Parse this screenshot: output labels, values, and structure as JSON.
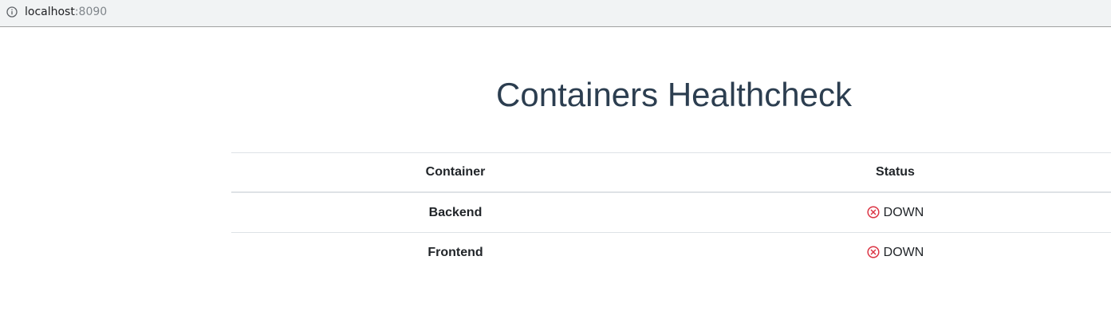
{
  "browser": {
    "url_host": "localhost",
    "url_port": ":8090",
    "info_icon": "info-icon"
  },
  "page": {
    "title": "Containers Healthcheck"
  },
  "table": {
    "headers": {
      "container": "Container",
      "status": "Status"
    },
    "rows": [
      {
        "container": "Backend",
        "status": "DOWN",
        "status_icon": "circle-x-icon"
      },
      {
        "container": "Frontend",
        "status": "DOWN",
        "status_icon": "circle-x-icon"
      }
    ]
  },
  "colors": {
    "title": "#2c3e50",
    "status_down": "#dc3545"
  }
}
